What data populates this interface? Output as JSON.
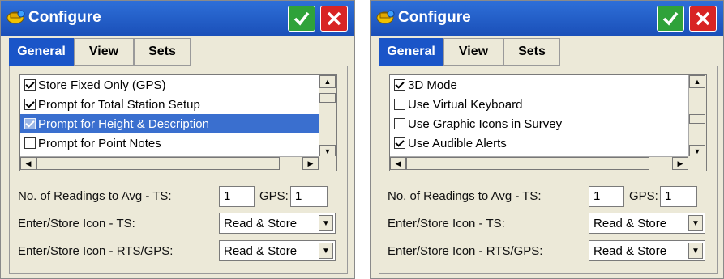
{
  "windows": [
    {
      "title": "Configure",
      "tabs": [
        "General",
        "View",
        "Sets"
      ],
      "active_tab": "General",
      "list_items": [
        {
          "label": "Store Fixed Only (GPS)",
          "checked": true,
          "selected": false
        },
        {
          "label": "Prompt for Total Station Setup",
          "checked": true,
          "selected": false
        },
        {
          "label": "Prompt for Height & Description",
          "checked": true,
          "selected": true
        },
        {
          "label": "Prompt for Point Notes",
          "checked": false,
          "selected": false
        }
      ],
      "readings_label": "No. of Readings to Avg  -  TS:",
      "ts_value": "1",
      "gps_label": "GPS:",
      "gps_value": "1",
      "ts_icon_label": "Enter/Store Icon - TS:",
      "ts_icon_value": "Read & Store",
      "rts_icon_label": "Enter/Store Icon - RTS/GPS:",
      "rts_icon_value": "Read & Store"
    },
    {
      "title": "Configure",
      "tabs": [
        "General",
        "View",
        "Sets"
      ],
      "active_tab": "General",
      "list_items": [
        {
          "label": "3D Mode",
          "checked": true,
          "selected": false
        },
        {
          "label": "Use Virtual Keyboard",
          "checked": false,
          "selected": false
        },
        {
          "label": "Use Graphic Icons in Survey",
          "checked": false,
          "selected": false
        },
        {
          "label": "Use Audible Alerts",
          "checked": true,
          "selected": false
        }
      ],
      "readings_label": "No. of Readings to Avg  -  TS:",
      "ts_value": "1",
      "gps_label": "GPS:",
      "gps_value": "1",
      "ts_icon_label": "Enter/Store Icon - TS:",
      "ts_icon_value": "Read & Store",
      "rts_icon_label": "Enter/Store Icon - RTS/GPS:",
      "rts_icon_value": "Read & Store"
    }
  ],
  "icons": {
    "ok": "checkmark-icon",
    "cancel": "close-x-icon",
    "app": "surveyor-helmet-icon",
    "scroll_up": "arrow-up-icon",
    "scroll_down": "arrow-down-icon",
    "scroll_left": "arrow-left-icon",
    "scroll_right": "arrow-right-icon",
    "dropdown": "chevron-down-icon"
  },
  "colors": {
    "titlebar": "#1a4fb8",
    "ok_button": "#2fa23a",
    "cancel_button": "#d82424",
    "selection": "#3a6fcf"
  }
}
